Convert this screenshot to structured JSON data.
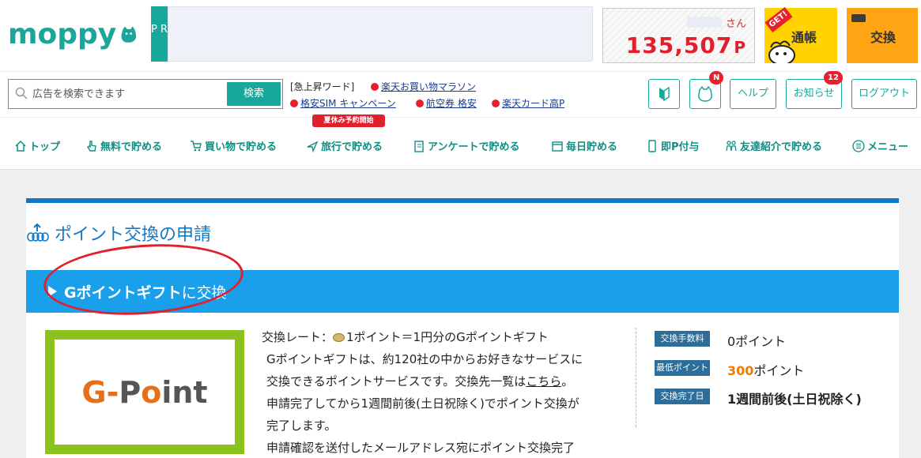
{
  "header": {
    "logo_text": "moppy",
    "pr_label": "P R",
    "user_suffix": "さん",
    "points_value": "135,507",
    "points_unit": "P",
    "tsucho_label": "通帳",
    "get_ribbon": "GET!",
    "koukan_label": "交換"
  },
  "search": {
    "placeholder": "広告を検索できます",
    "button_label": "検索",
    "keywords_title": "[急上昇ワード]",
    "keywords": [
      "楽天お買い物マラソン",
      "格安SIM キャンペーン",
      "航空券 格安",
      "楽天カード高P"
    ]
  },
  "util_buttons": {
    "help": "ヘルプ",
    "notice": "お知らせ",
    "logout": "ログアウト",
    "badge_new": "N",
    "badge_notice_count": "12"
  },
  "nav": {
    "items": [
      "トップ",
      "無料で貯める",
      "買い物で貯める",
      "旅行で貯める",
      "アンケートで貯める",
      "毎日貯める",
      "即P付与",
      "友達紹介で貯める",
      "メニュー"
    ],
    "summer_badge": "夏休み予約開始"
  },
  "main": {
    "page_title": "ポイント交換の申請",
    "section_title_bold": "Gポイントギフト",
    "section_title_rest": "に交換",
    "logo_text_g": "G",
    "logo_text_dash": "-",
    "logo_text_p": "P",
    "logo_text_o": "o",
    "logo_text_int": "int",
    "rate_line_prefix": "交換レート：",
    "rate_line_rest": "1ポイント＝1円分のGポイントギフト",
    "desc_line1": "Gポイントギフトは、約120社の中からお好きなサービスに",
    "desc_line2_pre": "交換できるポイントサービスです。交換先一覧は",
    "desc_line2_link": "こちら",
    "desc_line2_post": "。",
    "desc_line3": "申請完了してから1週間前後(土日祝除く)でポイント交換が",
    "desc_line4": "完了します。",
    "desc_line5": "申請確認を送付したメールアドレス宛にポイント交換完了",
    "info": [
      {
        "label": "交換手数料",
        "value": "0ポイント"
      },
      {
        "label": "最低ポイント",
        "value_highlight": "300",
        "value_rest": "ポイント"
      },
      {
        "label": "交換完了日",
        "value": "1週間前後(土日祝除く)"
      }
    ]
  },
  "colors": {
    "brand_teal": "#16a89a",
    "points_red": "#e0202c",
    "header_blue": "#1aa0ea",
    "gpoint_green": "#8cc21e"
  }
}
